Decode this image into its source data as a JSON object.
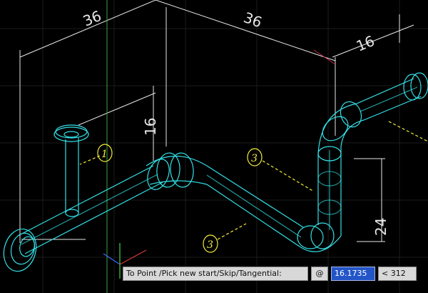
{
  "drawing": {
    "dimensions": [
      "36",
      "36",
      "16",
      "16",
      "24"
    ],
    "callouts": [
      "1",
      "3",
      "3"
    ]
  },
  "command_line": {
    "prompt": "To Point /Pick new start/Skip/Tangential:",
    "at_symbol": "@",
    "distance_value": "16.1735",
    "angle_value": "< 312"
  },
  "colors": {
    "background": "#000000",
    "pipe_wireframe": "#33e0e6",
    "dimension_lines": "#e8e8e8",
    "callout_yellow": "#f2ec3a",
    "value_highlight": "#2355c7"
  }
}
